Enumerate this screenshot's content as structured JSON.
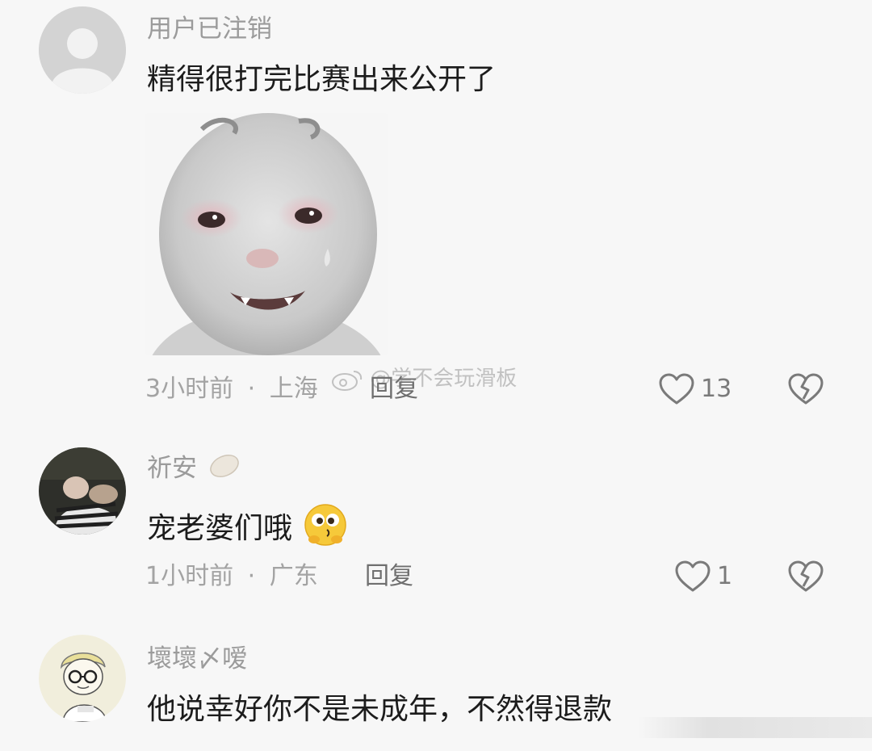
{
  "comments": [
    {
      "username": "用户已注销",
      "text": "精得很打完比赛出来公开了",
      "time": "3小时前",
      "location": "上海",
      "reply_label": "回复",
      "like_count": "13"
    },
    {
      "username": "祈安",
      "text": "宠老婆们哦",
      "time": "1小时前",
      "location": "广东",
      "reply_label": "回复",
      "like_count": "1"
    },
    {
      "username": "壞壞〆嗳",
      "text": "他说幸好你不是未成年，不然得退款"
    }
  ],
  "separator": "·",
  "watermark": "@学不会玩滑板",
  "colors": {
    "background": "#f7f7f7",
    "username": "#9b9b9b",
    "text": "#1c1c1c",
    "meta": "#a3a3a3"
  },
  "icons": {
    "like": "heart-outline-icon",
    "dislike": "broken-heart-icon"
  }
}
